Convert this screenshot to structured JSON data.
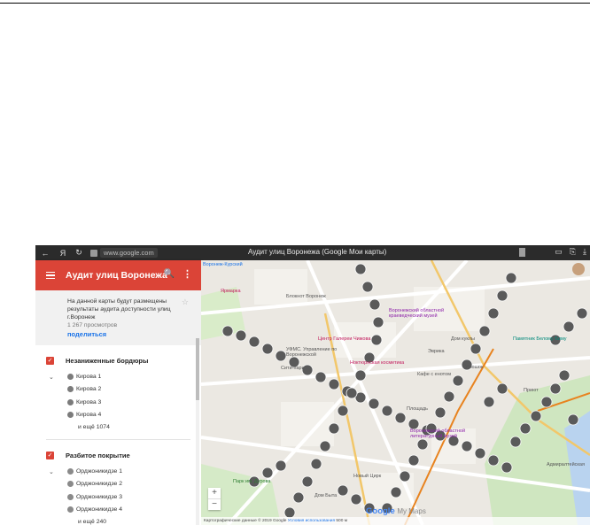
{
  "browser": {
    "back": "←",
    "yandex": "Я",
    "reload": "↻",
    "url": "www.google.com",
    "tab_title": "Аудит улиц Воронежа (Google Мои карты)"
  },
  "sidebar": {
    "title": "Аудит улиц Воронежа",
    "description": "На данной карты будут размещены результаты аудита доступности улиц г.Воронеж",
    "views": "1 267 просмотров",
    "share": "поделиться",
    "layers": [
      {
        "name": "Незаниженные бордюры",
        "items": [
          "Кирова 1",
          "Кирова 2",
          "Кирова 3",
          "Кирова 4"
        ],
        "more": "и ещё 1074"
      },
      {
        "name": "Разбитое покрытие",
        "items": [
          "Орджоникидзе 1",
          "Орджоникидзе 2",
          "Орджоникидзе 3",
          "Орджоникидзе 4"
        ],
        "more": "и ещё 240"
      }
    ]
  },
  "map": {
    "labels": [
      "Воронеж-Курский",
      "Ярмарка",
      "Блокнот Воронеж",
      "Центр Галереи Чижова",
      "УФМС. Управление по Воронежской",
      "Сити-парк",
      "Воронежский областной краеведческий музей",
      "Дом куклы",
      "Эврика",
      "Улюшок",
      "Памятник Белому Биму",
      "Кафе с енотом",
      "Воронежский областной литературный музей",
      "Парк им. Дурова",
      "Дом Быта",
      "Приют",
      "Площадь",
      "Ноктюрнская косметика",
      "Новый Цирк",
      "Адмиралтейская"
    ],
    "zoom_in": "+",
    "zoom_out": "−",
    "logo_google": "Google",
    "logo_mymaps": "My Maps",
    "attribution": "Картографические данные © 2019 Google",
    "terms": "Условия использования",
    "scale": "500 м"
  }
}
